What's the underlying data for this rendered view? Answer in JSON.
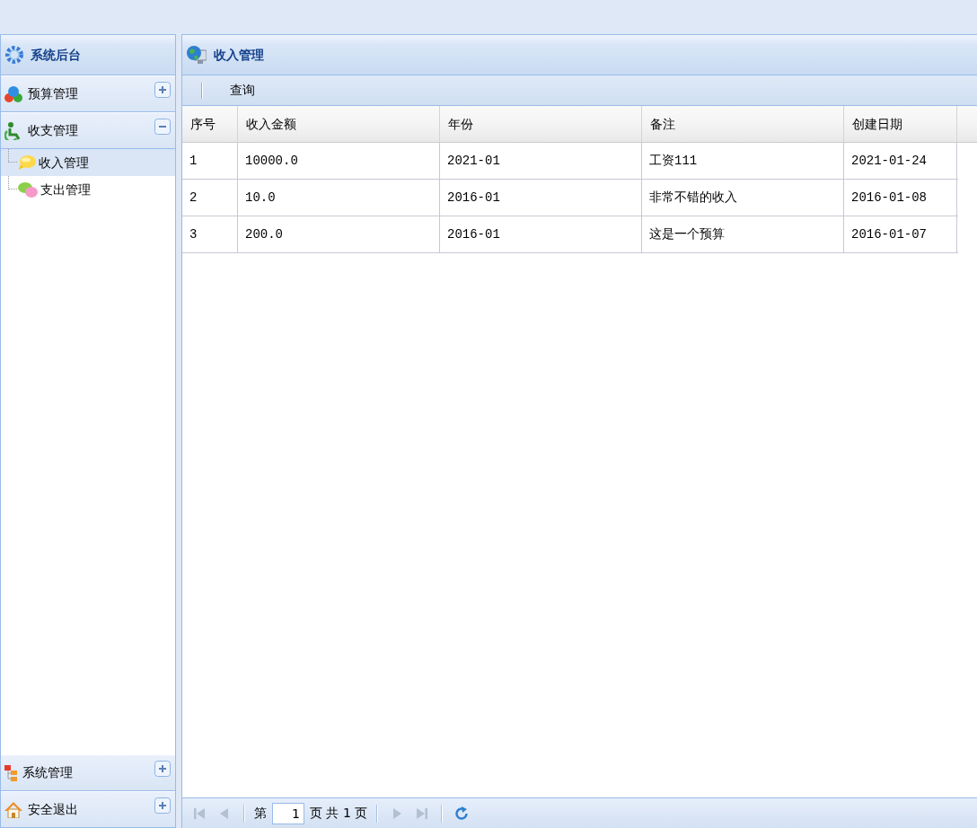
{
  "sidebar": {
    "title": "系统后台",
    "sections": [
      {
        "label": "预算管理",
        "expanded": false
      },
      {
        "label": "收支管理",
        "expanded": true,
        "items": [
          {
            "label": "收入管理",
            "selected": true
          },
          {
            "label": "支出管理",
            "selected": false
          }
        ]
      },
      {
        "label": "系统管理",
        "expanded": false
      },
      {
        "label": "安全退出",
        "expanded": false
      }
    ]
  },
  "content": {
    "title": "收入管理",
    "toolbar": [
      {
        "kind": "separator"
      },
      {
        "kind": "button",
        "label": "查询"
      }
    ],
    "table": {
      "columns": [
        "序号",
        "收入金额",
        "年份",
        "备注",
        "创建日期"
      ],
      "rows": [
        [
          "1",
          "10000.0",
          "2021-01",
          "工资111",
          "2021-01-24"
        ],
        [
          "2",
          "10.0",
          "2016-01",
          "非常不错的收入",
          "2016-01-08"
        ],
        [
          "3",
          "200.0",
          "2016-01",
          "这是一个预算",
          "2016-01-07"
        ]
      ]
    },
    "pager": [
      {
        "kind": "first",
        "disabled": true
      },
      {
        "kind": "prev",
        "disabled": true
      },
      {
        "kind": "separator"
      },
      {
        "kind": "label",
        "text": "第"
      },
      {
        "kind": "page_input",
        "value": "1"
      },
      {
        "kind": "label",
        "text": "页 共 1 页"
      },
      {
        "kind": "separator"
      },
      {
        "kind": "next",
        "disabled": true
      },
      {
        "kind": "last",
        "disabled": true
      },
      {
        "kind": "separator"
      },
      {
        "kind": "refresh",
        "disabled": false
      }
    ]
  }
}
